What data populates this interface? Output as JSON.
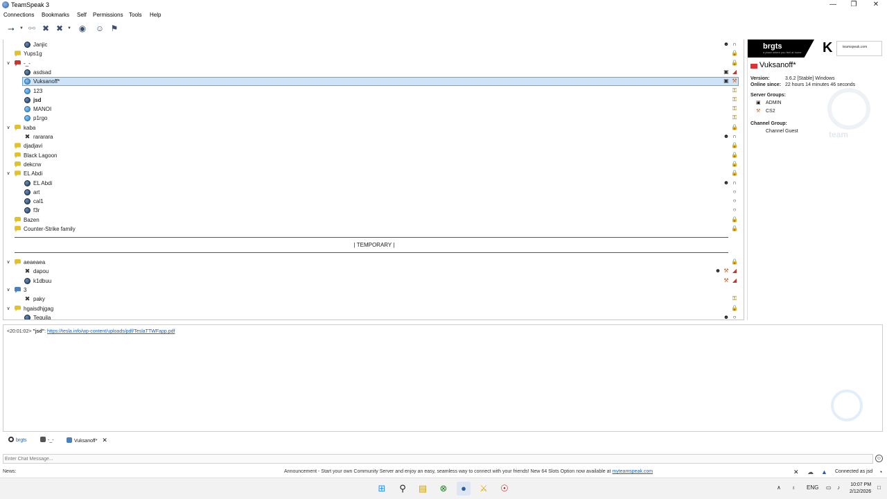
{
  "window": {
    "title": "TeamSpeak 3",
    "controls": [
      "—",
      "❐",
      "✕"
    ]
  },
  "menu": [
    "Connections",
    "Bookmarks",
    "Self",
    "Permissions",
    "Tools",
    "Help"
  ],
  "tree": {
    "rows": [
      {
        "kind": "user",
        "label": "Janjic",
        "icon": "user-icon",
        "indent": 2,
        "right": [
          "users-icon",
          "headset-icon"
        ]
      },
      {
        "kind": "channel",
        "label": "Yups1g",
        "indent": 1,
        "right": [
          "lock-icon"
        ]
      },
      {
        "kind": "channel",
        "label": "-_-",
        "indent": 1,
        "expanded": true,
        "color": "red",
        "right": [
          "lock-icon"
        ]
      },
      {
        "kind": "user",
        "label": "asdsad",
        "indent": 2,
        "right": [
          "admin-badge-icon",
          "mic-muted-icon"
        ]
      },
      {
        "kind": "user",
        "label": "Vuksanoff*",
        "indent": 2,
        "talk": true,
        "selected": true,
        "right": [
          "admin-badge-icon",
          "cs2-badge-icon"
        ]
      },
      {
        "kind": "user",
        "label": "123",
        "indent": 2,
        "talk": true,
        "right": [
          "key-icon"
        ]
      },
      {
        "kind": "user",
        "label": "jsd",
        "indent": 2,
        "bold": true,
        "right": [
          "key-icon"
        ]
      },
      {
        "kind": "user",
        "label": "MANOI",
        "indent": 2,
        "talk": true,
        "right": [
          "key-icon"
        ]
      },
      {
        "kind": "user",
        "label": "p1rgo",
        "indent": 2,
        "talk": true,
        "right": [
          "key-icon"
        ]
      },
      {
        "kind": "channel",
        "label": "kaba",
        "indent": 1,
        "expanded": true,
        "right": [
          "lock-icon"
        ]
      },
      {
        "kind": "away",
        "label": "rararara",
        "indent": 2,
        "right": [
          "users-icon",
          "headset-icon"
        ]
      },
      {
        "kind": "channel",
        "label": "djadjavi",
        "indent": 1,
        "right": [
          "lock-icon"
        ]
      },
      {
        "kind": "channel",
        "label": "Black Lagoon",
        "indent": 1,
        "right": [
          "lock-icon"
        ]
      },
      {
        "kind": "channel",
        "label": "dekcrw",
        "indent": 1,
        "right": [
          "lock-icon"
        ]
      },
      {
        "kind": "channel",
        "label": "EL Abdi",
        "indent": 1,
        "expanded": true,
        "right": [
          "lock-icon"
        ]
      },
      {
        "kind": "user",
        "label": "EL Abdi",
        "indent": 2,
        "right": [
          "users-icon",
          "headset-icon"
        ]
      },
      {
        "kind": "user",
        "label": "art",
        "indent": 2,
        "right": [
          "ts-icon"
        ]
      },
      {
        "kind": "user",
        "label": "cal1",
        "indent": 2,
        "right": [
          "ts-icon"
        ]
      },
      {
        "kind": "user",
        "label": "f3r",
        "indent": 2,
        "right": [
          "ts-icon"
        ]
      },
      {
        "kind": "channel",
        "label": "Bazen",
        "indent": 1,
        "right": [
          "lock-icon"
        ]
      },
      {
        "kind": "channel",
        "label": "Counter-Strike family",
        "indent": 1,
        "right": [
          "lock-icon"
        ]
      }
    ],
    "spacer": "| TEMPORARY |",
    "rows2": [
      {
        "kind": "channel",
        "label": "aeaeaea",
        "indent": 1,
        "expanded": true,
        "right": [
          "lock-icon"
        ]
      },
      {
        "kind": "away",
        "label": "dapou",
        "indent": 2,
        "right": [
          "users-icon",
          "cs2-badge-icon",
          "mic-muted-icon"
        ]
      },
      {
        "kind": "user",
        "label": "k1dbuu",
        "indent": 2,
        "right": [
          "cs2-badge-icon",
          "mic-muted-icon"
        ]
      },
      {
        "kind": "channel",
        "label": "3",
        "indent": 1,
        "expanded": true,
        "color": "blue",
        "right": []
      },
      {
        "kind": "away",
        "label": "paky",
        "indent": 2,
        "right": [
          "key-icon"
        ]
      },
      {
        "kind": "channel",
        "label": "hgaisdhjgag",
        "indent": 1,
        "expanded": true,
        "right": [
          "lock-icon"
        ]
      },
      {
        "kind": "user",
        "label": "Tequila",
        "indent": 2,
        "right": [
          "users-icon",
          "ts-icon"
        ]
      }
    ]
  },
  "info": {
    "banner_brand": "brgts",
    "banner_tagline": "a place where you feel at home",
    "banner_k": "K",
    "banner_ts": "teamspeak.com",
    "username": "Vuksanoff*",
    "version_label": "Version:",
    "version_value": "3.6.2 [Stable] Windows",
    "online_label": "Online since:",
    "online_value": "22 hours 14 minutes 46 seconds",
    "server_groups_label": "Server Groups:",
    "server_groups": [
      "ADMIN",
      "CS2"
    ],
    "channel_group_label": "Channel Group:",
    "channel_group": "Channel Guest",
    "watermark": "team"
  },
  "chat": {
    "prefix": "<20:01:02> ",
    "sender": "\"jsd\"",
    "sep": ": ",
    "link": "https://tesla.info/wp-content/uploads/pdf/TeslaTTWFapp.pdf"
  },
  "tabs": [
    {
      "label": "brgts",
      "icon": "server-icon"
    },
    {
      "label": "-_-",
      "icon": "channel-icon"
    },
    {
      "label": "Vuksanoff*",
      "icon": "chat-icon",
      "closable": true
    }
  ],
  "chat_input_placeholder": "Enter Chat Message...",
  "status": {
    "news": "News:",
    "announcement": "Announcement - Start your own Community Server and enjoy an easy, seamless way to connect with your friends! New 64 Slots Option now available at ",
    "announcement_link": "myteamspeak.com",
    "connected": "Connected as jsd"
  },
  "taskbar": {
    "lang": "ENG",
    "time": "10:07 PM",
    "date": "2/12/2026"
  }
}
